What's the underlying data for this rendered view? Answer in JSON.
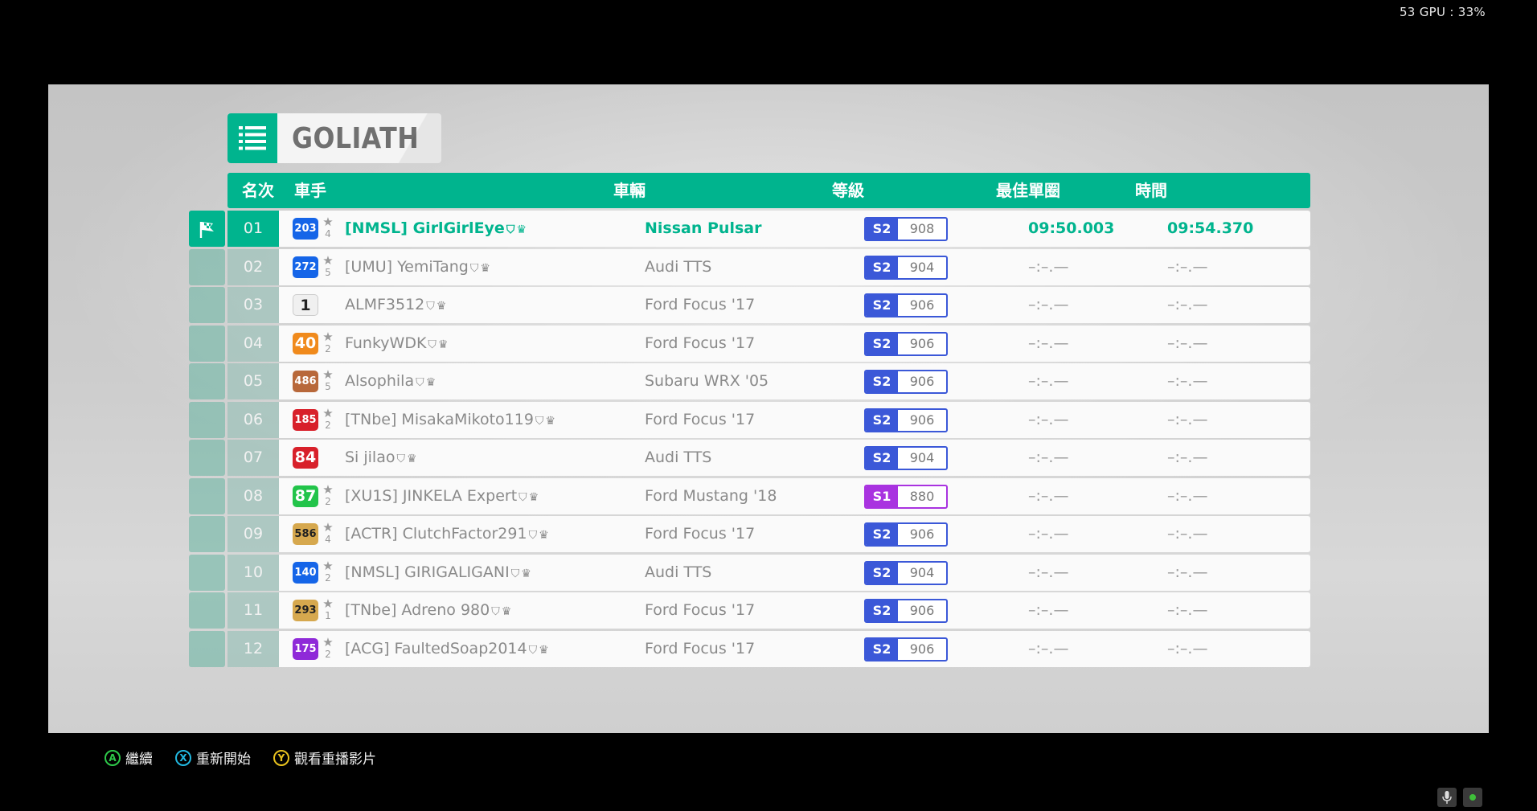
{
  "perf": {
    "text": "53 GPU : 33%"
  },
  "title": {
    "text": "GOLIATH"
  },
  "columns": {
    "rank": "名次",
    "driver": "車手",
    "car": "車輛",
    "class": "等級",
    "best_lap": "最佳單圈",
    "time": "時間"
  },
  "rows": [
    {
      "rank": "01",
      "level": "203",
      "level_color": "#1565e8",
      "stars": "4",
      "driver": "[NMSL] GirlGirlEye",
      "car": "Nissan Pulsar",
      "cls": "S2",
      "pi": "908",
      "best": "09:50.003",
      "time": "09:54.370",
      "active": true
    },
    {
      "rank": "02",
      "level": "272",
      "level_color": "#1565e8",
      "stars": "5",
      "driver": "[UMU] YemiTang",
      "car": "Audi TTS",
      "cls": "S2",
      "pi": "904",
      "best": "–:–.—",
      "time": "–:–.—"
    },
    {
      "rank": "03",
      "level": "1",
      "level_color": "#f0f0f0",
      "stars": "",
      "driver": "ALMF3512",
      "car": "Ford Focus '17",
      "cls": "S2",
      "pi": "906",
      "best": "–:–.—",
      "time": "–:–.—"
    },
    {
      "rank": "04",
      "level": "40",
      "level_color": "#f08a1c",
      "stars": "2",
      "driver": "FunkyWDK",
      "car": "Ford Focus '17",
      "cls": "S2",
      "pi": "906",
      "best": "–:–.—",
      "time": "–:–.—"
    },
    {
      "rank": "05",
      "level": "486",
      "level_color": "#b8683a",
      "stars": "5",
      "driver": "Alsophila",
      "car": "Subaru WRX '05",
      "cls": "S2",
      "pi": "906",
      "best": "–:–.—",
      "time": "–:–.—"
    },
    {
      "rank": "06",
      "level": "185",
      "level_color": "#d8202a",
      "stars": "2",
      "driver": "[TNbe] MisakaMikoto119",
      "car": "Ford Focus '17",
      "cls": "S2",
      "pi": "906",
      "best": "–:–.—",
      "time": "–:–.—"
    },
    {
      "rank": "07",
      "level": "84",
      "level_color": "#d8202a",
      "stars": "",
      "driver": "Si jilao",
      "car": "Audi TTS",
      "cls": "S2",
      "pi": "904",
      "best": "–:–.—",
      "time": "–:–.—"
    },
    {
      "rank": "08",
      "level": "87",
      "level_color": "#22c44a",
      "stars": "2",
      "driver": "[XU1S] JINKELA Expert",
      "car": "Ford Mustang '18",
      "cls": "S1",
      "pi": "880",
      "best": "–:–.—",
      "time": "–:–.—"
    },
    {
      "rank": "09",
      "level": "586",
      "level_color": "#d6a84e",
      "stars": "4",
      "driver": "[ACTR] ClutchFactor291",
      "car": "Ford Focus '17",
      "cls": "S2",
      "pi": "906",
      "best": "–:–.—",
      "time": "–:–.—"
    },
    {
      "rank": "10",
      "level": "140",
      "level_color": "#1565e8",
      "stars": "2",
      "driver": "[NMSL] GIRIGALIGANI",
      "car": "Audi TTS",
      "cls": "S2",
      "pi": "904",
      "best": "–:–.—",
      "time": "–:–.—"
    },
    {
      "rank": "11",
      "level": "293",
      "level_color": "#d6a84e",
      "stars": "1",
      "driver": "[TNbe] Adreno 980",
      "car": "Ford Focus '17",
      "cls": "S2",
      "pi": "906",
      "best": "–:–.—",
      "time": "–:–.—"
    },
    {
      "rank": "12",
      "level": "175",
      "level_color": "#8f2ad8",
      "stars": "2",
      "driver": "[ACG] FaultedSoap2014",
      "car": "Ford Focus '17",
      "cls": "S2",
      "pi": "906",
      "best": "–:–.—",
      "time": "–:–.—"
    }
  ],
  "footer": {
    "a_key": "A",
    "a_label": "繼續",
    "x_key": "X",
    "x_label": "重新開始",
    "y_key": "Y",
    "y_label": "觀看重播影片"
  },
  "colors": {
    "accent": "#00b48e",
    "class_s2": "#3b58d8",
    "class_s1": "#a933e0",
    "btn_a": "#2ec84a",
    "btn_x": "#22b8e0",
    "btn_y": "#e8c21e"
  }
}
